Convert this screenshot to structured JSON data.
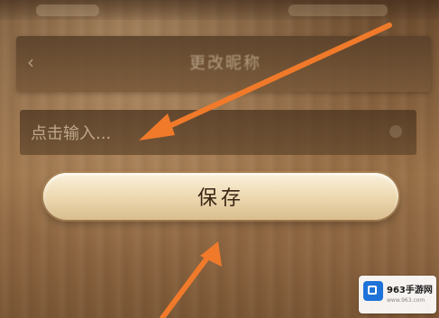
{
  "header": {
    "title": "更改昵称",
    "back_icon": "chevron-left-icon"
  },
  "form": {
    "input_placeholder": "点击输入...",
    "input_value": "",
    "save_label": "保存"
  },
  "annotations": {
    "arrow_color": "#f07a2a"
  },
  "watermark": {
    "name": "963手游网",
    "url": "www.963.com"
  },
  "colors": {
    "save_button": "#efdcb6",
    "background": "#8a6440"
  }
}
